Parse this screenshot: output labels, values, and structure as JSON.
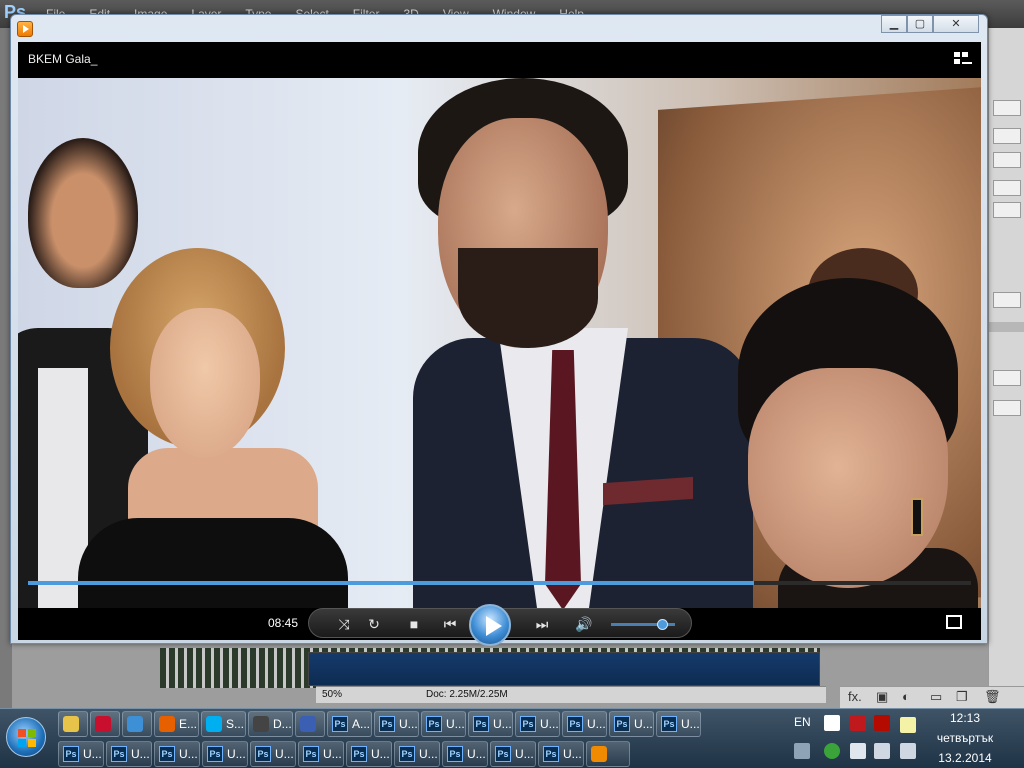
{
  "photoshop": {
    "menu": [
      "File",
      "Edit",
      "Image",
      "Layer",
      "Type",
      "Select",
      "Filter",
      "3D",
      "View",
      "Window",
      "Help"
    ],
    "logo": "Ps",
    "zoom": "50%",
    "doc_info": "Doc: 2.25M/2.25M",
    "fx_label": "fx."
  },
  "player": {
    "title": "BKEM Gala_",
    "elapsed": "08:45",
    "progress": 0.77,
    "volume": 0.8,
    "controls": {
      "shuffle": "shuffle",
      "repeat": "repeat",
      "stop": "stop",
      "previous": "previous",
      "play": "play",
      "next": "next",
      "mute": "mute",
      "fullscreen": "fullscreen"
    }
  },
  "taskbar": {
    "row1": [
      {
        "icon": "folder-icon",
        "label": ""
      },
      {
        "icon": "flag-uk-icon",
        "label": ""
      },
      {
        "icon": "ie-icon",
        "label": ""
      },
      {
        "icon": "firefox-icon",
        "label": "E..."
      },
      {
        "icon": "skype-icon",
        "label": "S..."
      },
      {
        "icon": "camera-icon",
        "label": "D..."
      },
      {
        "icon": "save-icon",
        "label": ""
      },
      {
        "icon": "ps-icon",
        "label": "A..."
      },
      {
        "icon": "ps-icon",
        "label": "U..."
      },
      {
        "icon": "ps-icon",
        "label": "U..."
      },
      {
        "icon": "ps-icon",
        "label": "U..."
      },
      {
        "icon": "ps-icon",
        "label": "U..."
      },
      {
        "icon": "ps-icon",
        "label": "U..."
      },
      {
        "icon": "ps-icon",
        "label": "U..."
      },
      {
        "icon": "ps-icon",
        "label": "U..."
      }
    ],
    "row2": [
      {
        "icon": "ps-icon",
        "label": "U..."
      },
      {
        "icon": "ps-icon",
        "label": "U..."
      },
      {
        "icon": "ps-icon",
        "label": "U..."
      },
      {
        "icon": "ps-icon",
        "label": "U..."
      },
      {
        "icon": "ps-icon",
        "label": "U..."
      },
      {
        "icon": "ps-icon",
        "label": "U..."
      },
      {
        "icon": "ps-icon",
        "label": "U..."
      },
      {
        "icon": "ps-icon",
        "label": "U..."
      },
      {
        "icon": "ps-icon",
        "label": "U..."
      },
      {
        "icon": "ps-icon",
        "label": "U..."
      },
      {
        "icon": "ps-icon",
        "label": "U..."
      },
      {
        "icon": "media-player-icon",
        "label": ""
      }
    ],
    "tray": {
      "language": "EN",
      "time": "12:13",
      "day": "четвъртък",
      "date": "13.2.2014"
    }
  }
}
